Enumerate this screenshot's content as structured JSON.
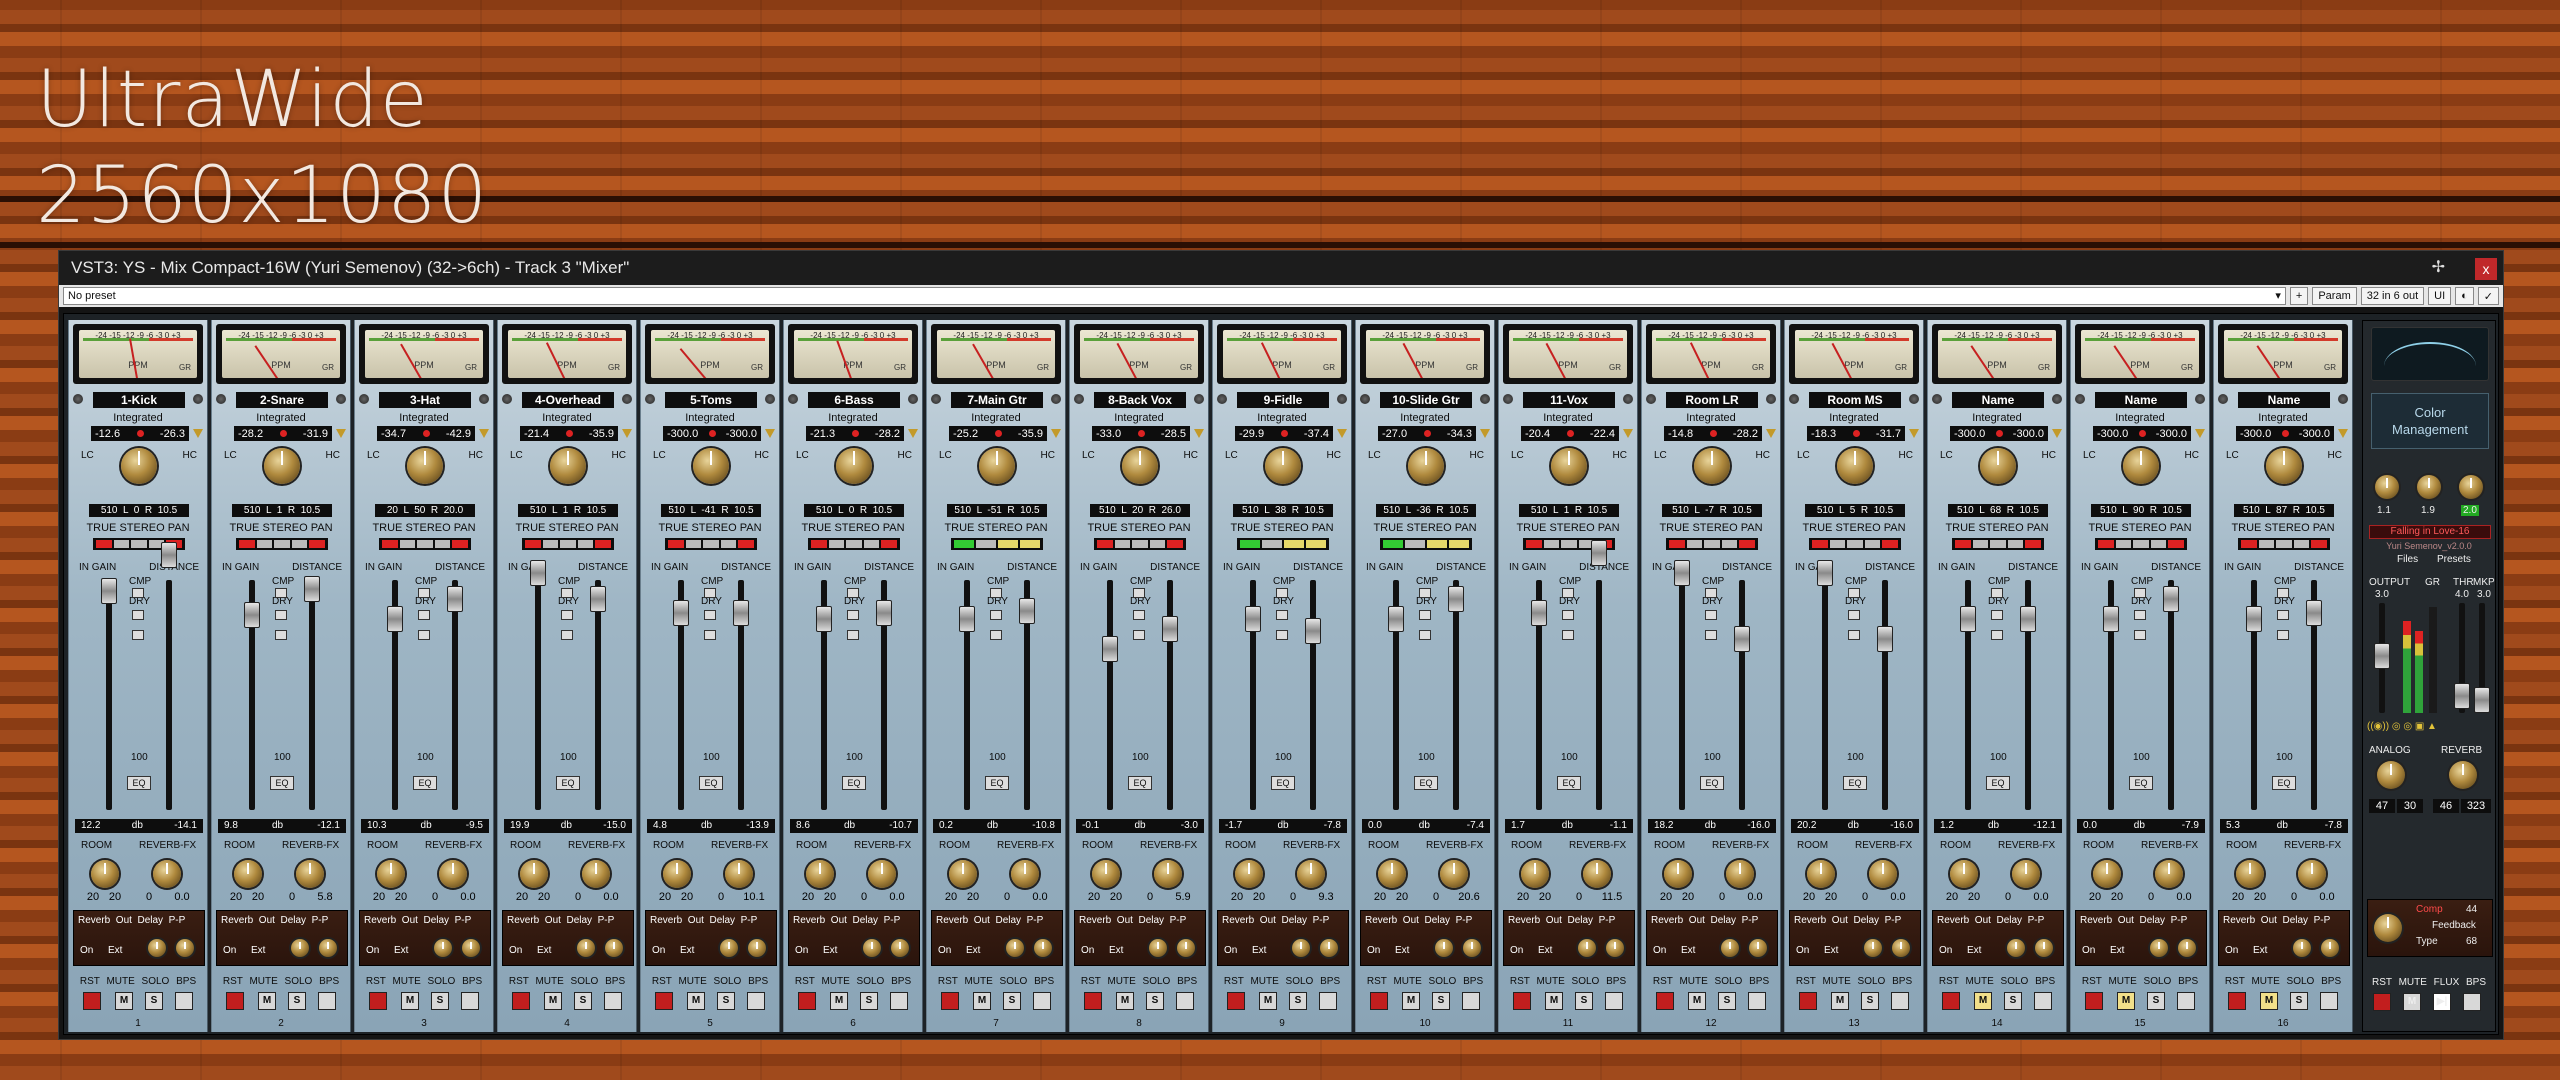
{
  "background_title": [
    "UltraWide",
    "2560x1080"
  ],
  "window": {
    "title": "VST3: YS - Mix Compact-16W (Yuri Semenov) (32->6ch) - Track 3 \"Mixer\"",
    "pin_icon": "pin-icon",
    "close": "x"
  },
  "toolbar": {
    "preset": "No preset",
    "plus": "+",
    "param": "Param",
    "io": "32 in 6 out",
    "ui": "UI",
    "check": "✓"
  },
  "labels": {
    "integrated": "Integrated",
    "lc": "LC",
    "hc": "HC",
    "true_stereo_pan": "TRUE STEREO PAN",
    "in_gain": "IN GAIN",
    "distance": "DISTANCE",
    "cmp": "CMP",
    "dry": "DRY",
    "eq": "EQ",
    "db": "db",
    "room": "ROOM",
    "reverb_fx": "REVERB-FX",
    "rev_top": "Reverb  Out  Delay  P-P",
    "on": "On",
    "ext": "Ext",
    "rst_row": "RST MUTE SOLO BPS",
    "m": "M",
    "s": "S",
    "hundred": "100"
  },
  "strips": [
    {
      "name": "1-Kick",
      "lufs_l": "-12.6",
      "lufs_r": "-26.3",
      "pan": "510  L  0  R  10.5",
      "gain": "12.2",
      "dist": "-14.1",
      "room_a": "20",
      "room_b": "20",
      "fx_a": "0",
      "fx_b": "0.0",
      "mute_on": false,
      "num": "1"
    },
    {
      "name": "2-Snare",
      "lufs_l": "-28.2",
      "lufs_r": "-31.9",
      "pan": "510  L  1  R  10.5",
      "gain": "9.8",
      "dist": "-12.1",
      "room_a": "20",
      "room_b": "20",
      "fx_a": "0",
      "fx_b": "5.8",
      "mute_on": false,
      "num": "2"
    },
    {
      "name": "3-Hat",
      "lufs_l": "-34.7",
      "lufs_r": "-42.9",
      "pan": "20  L  50  R  20.0",
      "gain": "10.3",
      "dist": "-9.5",
      "room_a": "20",
      "room_b": "20",
      "fx_a": "0",
      "fx_b": "0.0",
      "mute_on": false,
      "num": "3"
    },
    {
      "name": "4-Overhead",
      "lufs_l": "-21.4",
      "lufs_r": "-35.9",
      "pan": "510  L  1  R  10.5",
      "gain": "19.9",
      "dist": "-15.0",
      "room_a": "20",
      "room_b": "20",
      "fx_a": "0",
      "fx_b": "0.0",
      "mute_on": false,
      "num": "4"
    },
    {
      "name": "5-Toms",
      "lufs_l": "-300.0",
      "lufs_r": "-300.0",
      "pan": "510  L  -41  R  10.5",
      "gain": "4.8",
      "dist": "-13.9",
      "room_a": "20",
      "room_b": "20",
      "fx_a": "0",
      "fx_b": "10.1",
      "mute_on": false,
      "num": "5"
    },
    {
      "name": "6-Bass",
      "lufs_l": "-21.3",
      "lufs_r": "-28.2",
      "pan": "510  L  0  R  10.5",
      "gain": "8.6",
      "dist": "-10.7",
      "room_a": "20",
      "room_b": "20",
      "fx_a": "0",
      "fx_b": "0.0",
      "mute_on": false,
      "num": "6"
    },
    {
      "name": "7-Main Gtr",
      "lufs_l": "-25.2",
      "lufs_r": "-35.9",
      "pan": "510  L  -51  R  10.5",
      "gain": "0.2",
      "dist": "-10.8",
      "room_a": "20",
      "room_b": "20",
      "fx_a": "0",
      "fx_b": "0.0",
      "mute_on": false,
      "num": "7"
    },
    {
      "name": "8-Back Vox",
      "lufs_l": "-33.0",
      "lufs_r": "-28.5",
      "pan": "510  L  20  R  26.0",
      "gain": "-0.1",
      "dist": "-3.0",
      "room_a": "20",
      "room_b": "20",
      "fx_a": "0",
      "fx_b": "5.9",
      "mute_on": false,
      "num": "8"
    },
    {
      "name": "9-Fidle",
      "lufs_l": "-29.9",
      "lufs_r": "-37.4",
      "pan": "510  L  38  R  10.5",
      "gain": "-1.7",
      "dist": "-7.8",
      "room_a": "20",
      "room_b": "20",
      "fx_a": "0",
      "fx_b": "9.3",
      "mute_on": false,
      "num": "9"
    },
    {
      "name": "10-Slide Gtr",
      "lufs_l": "-27.0",
      "lufs_r": "-34.3",
      "pan": "510  L  -36  R  10.5",
      "gain": "0.0",
      "dist": "-7.4",
      "room_a": "20",
      "room_b": "20",
      "fx_a": "0",
      "fx_b": "20.6",
      "mute_on": false,
      "num": "10"
    },
    {
      "name": "11-Vox",
      "lufs_l": "-20.4",
      "lufs_r": "-22.4",
      "pan": "510  L  1  R  10.5",
      "gain": "1.7",
      "dist": "-1.1",
      "room_a": "20",
      "room_b": "20",
      "fx_a": "0",
      "fx_b": "11.5",
      "mute_on": false,
      "num": "11"
    },
    {
      "name": "Room LR",
      "lufs_l": "-14.8",
      "lufs_r": "-28.2",
      "pan": "510  L  -7  R  10.5",
      "gain": "18.2",
      "dist": "-16.0",
      "room_a": "20",
      "room_b": "20",
      "fx_a": "0",
      "fx_b": "0.0",
      "mute_on": false,
      "num": "12"
    },
    {
      "name": "Room MS",
      "lufs_l": "-18.3",
      "lufs_r": "-31.7",
      "pan": "510  L  5  R  10.5",
      "gain": "20.2",
      "dist": "-16.0",
      "room_a": "20",
      "room_b": "20",
      "fx_a": "0",
      "fx_b": "0.0",
      "mute_on": false,
      "num": "13"
    },
    {
      "name": "Name",
      "lufs_l": "-300.0",
      "lufs_r": "-300.0",
      "pan": "510  L  68  R  10.5",
      "gain": "1.2",
      "dist": "-12.1",
      "room_a": "20",
      "room_b": "20",
      "fx_a": "0",
      "fx_b": "0.0",
      "mute_on": true,
      "num": "14"
    },
    {
      "name": "Name",
      "lufs_l": "-300.0",
      "lufs_r": "-300.0",
      "pan": "510  L  90  R  10.5",
      "gain": "0.0",
      "dist": "-7.9",
      "room_a": "20",
      "room_b": "20",
      "fx_a": "0",
      "fx_b": "0.0",
      "mute_on": true,
      "num": "15"
    },
    {
      "name": "Name",
      "lufs_l": "-300.0",
      "lufs_r": "-300.0",
      "pan": "510  L  87  R  10.5",
      "gain": "5.3",
      "dist": "-7.8",
      "room_a": "20",
      "room_b": "20",
      "fx_a": "0",
      "fx_b": "0.0",
      "mute_on": true,
      "num": "16"
    }
  ],
  "master": {
    "color_mgmt": [
      "Color",
      "Management"
    ],
    "knob_vals": [
      "1.1",
      "1.9",
      "2.0"
    ],
    "preset_name": "Falling in Love-16",
    "version": "Yuri Semenov_v2.0.0",
    "files": "Files",
    "presets": "Presets",
    "output": "OUTPUT",
    "gr": "GR",
    "thr": "THR",
    "mkp": "MKP",
    "out_val": "3.0",
    "thr_val": "4.0",
    "mkp_val": "3.0",
    "analog": "ANALOG",
    "reverb": "REVERB",
    "a1": "47",
    "a2": "30",
    "r1": "46",
    "r2": "323",
    "comp": "Comp",
    "comp_val": "44",
    "feedback": "Feedback",
    "type": "Type",
    "type_val": "68",
    "bot": "RST MUTE FLUX BPS"
  }
}
